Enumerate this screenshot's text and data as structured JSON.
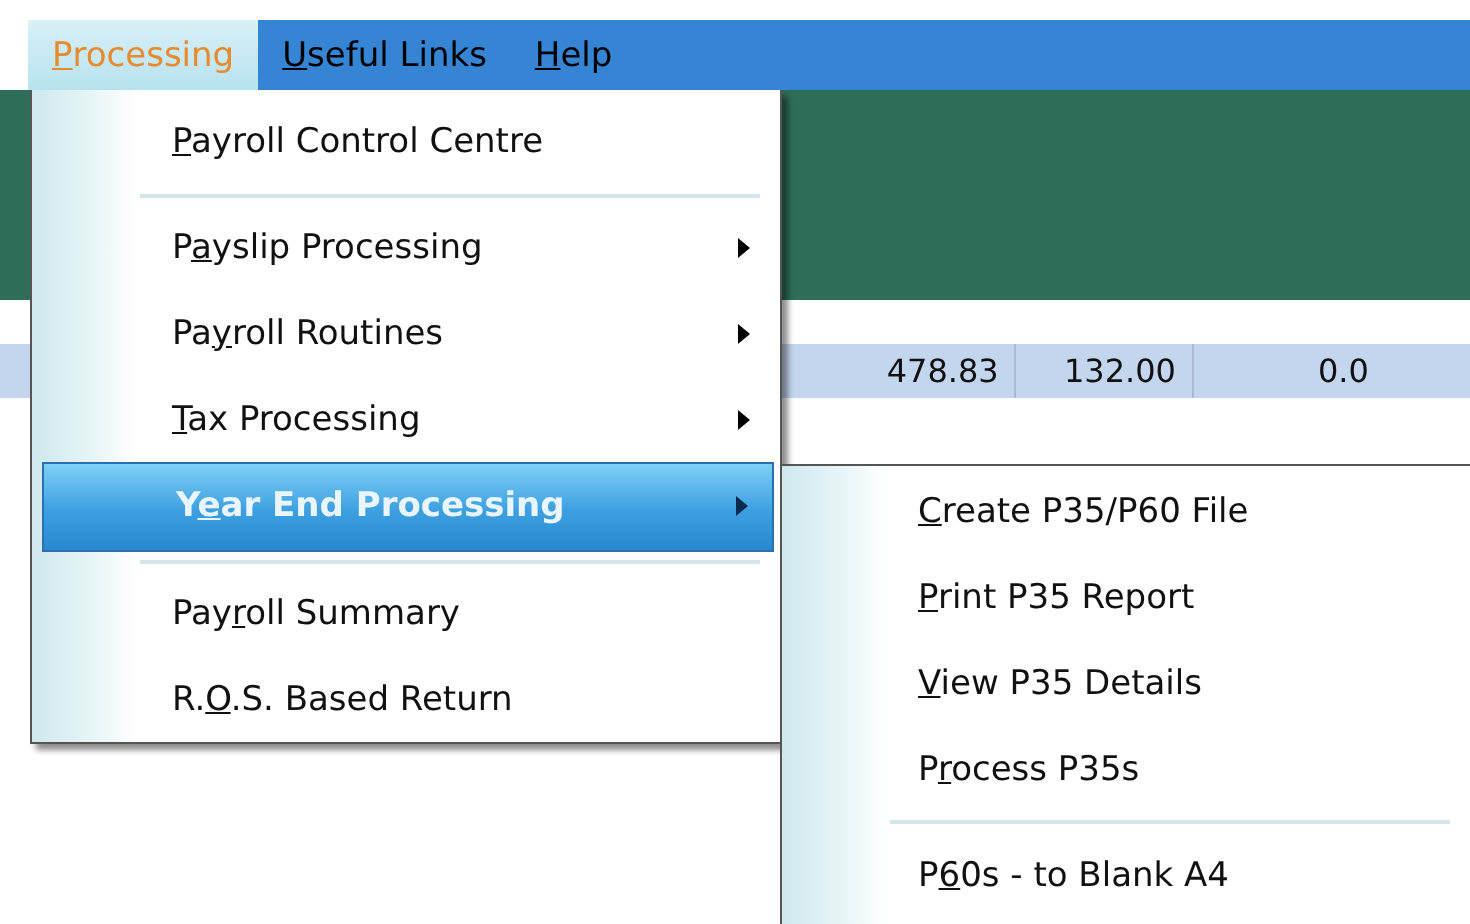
{
  "menu_bar": [
    {
      "access_key": "P",
      "label_after": "rocessing",
      "selected": true
    },
    {
      "access_key": "U",
      "label_after": "seful Links",
      "selected": false
    },
    {
      "access_key": "H",
      "label_after": "elp",
      "selected": false
    }
  ],
  "grid_row": {
    "cells": [
      "478.83",
      "132.00",
      "0.0"
    ]
  },
  "processing_menu": [
    {
      "kind": "item",
      "access_key": "P",
      "label_after": "ayroll Control Centre",
      "submenu": false,
      "selected": false
    },
    {
      "kind": "separator"
    },
    {
      "kind": "item",
      "label_before": "P",
      "access_key": "a",
      "label_after": "yslip Processing",
      "submenu": true,
      "selected": false
    },
    {
      "kind": "item",
      "label_before": "Pa",
      "access_key": "y",
      "label_after": "roll Routines",
      "submenu": true,
      "selected": false
    },
    {
      "kind": "item",
      "access_key": "T",
      "label_after": "ax Processing",
      "submenu": true,
      "selected": false
    },
    {
      "kind": "item",
      "label_before": "Y",
      "access_key": "e",
      "label_after": "ar End Processing",
      "submenu": true,
      "selected": true
    },
    {
      "kind": "separator"
    },
    {
      "kind": "item",
      "label_before": "Pay",
      "access_key": "r",
      "label_after": "oll Summary",
      "submenu": false,
      "selected": false
    },
    {
      "kind": "item",
      "label_before": "R.",
      "access_key": "O",
      "label_after": ".S. Based Return",
      "submenu": false,
      "selected": false
    }
  ],
  "year_end_submenu": [
    {
      "kind": "item",
      "access_key": "C",
      "label_after": "reate P35/P60 File",
      "submenu": false,
      "selected": false
    },
    {
      "kind": "item",
      "access_key": "P",
      "label_after": "rint P35 Report",
      "submenu": false,
      "selected": false
    },
    {
      "kind": "item",
      "access_key": "V",
      "label_after": "iew P35 Details",
      "submenu": false,
      "selected": false
    },
    {
      "kind": "item",
      "label_before": "P",
      "access_key": "r",
      "label_after": "ocess P35s",
      "submenu": false,
      "selected": false
    },
    {
      "kind": "separator"
    },
    {
      "kind": "item",
      "label_before": "P",
      "access_key": "6",
      "label_after": "0s - to Blank A4",
      "submenu": false,
      "selected": false
    }
  ]
}
